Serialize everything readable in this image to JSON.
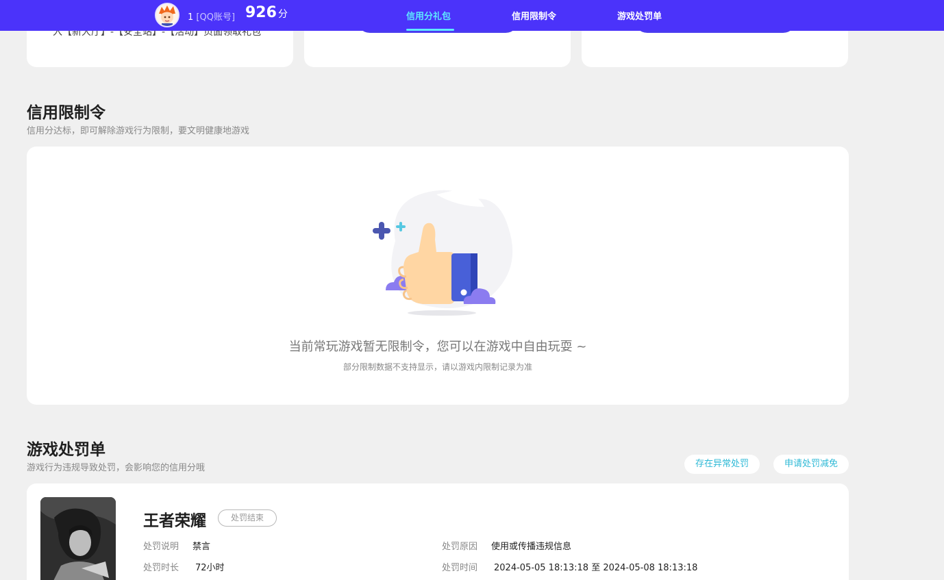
{
  "header": {
    "account_id": "1",
    "account_type": "[QQ账号]",
    "score": "926",
    "score_unit": "分",
    "nav": [
      {
        "label": "信用分礼包",
        "active": true
      },
      {
        "label": "信用限制令",
        "active": false
      },
      {
        "label": "游戏处罚单",
        "active": false
      }
    ]
  },
  "top_cards": {
    "card1_text": "入【新大厅】-【安全站】-【活动】页面领取礼包"
  },
  "restriction": {
    "title": "信用限制令",
    "subtitle": "信用分达标，即可解除游戏行为限制，要文明健康地游戏",
    "empty_main": "当前常玩游戏暂无限制令，您可以在游戏中自由玩耍 ~",
    "empty_sub": "部分限制数据不支持显示，请以游戏内限制记录为准"
  },
  "punishment": {
    "title": "游戏处罚单",
    "subtitle": "游戏行为违规导致处罚，会影响您的信用分哦",
    "btn_abnormal": "存在异常处罚",
    "btn_appeal": "申请处罚减免",
    "record": {
      "game": "王者荣耀",
      "status": "处罚结束",
      "desc_label": "处罚说明",
      "desc_value": "禁言",
      "reason_label": "处罚原因",
      "reason_value": "使用或传播违规信息",
      "duration_label": "处罚时长",
      "duration_value": "72小时",
      "time_label": "处罚时间",
      "time_value": "2024-05-05 18:13:18 至 2024-05-08 18:13:18"
    }
  },
  "colors": {
    "header_bg": "#4b33fa",
    "accent_cyan": "#5ee8ff",
    "pill_text": "#2eb9d6"
  }
}
